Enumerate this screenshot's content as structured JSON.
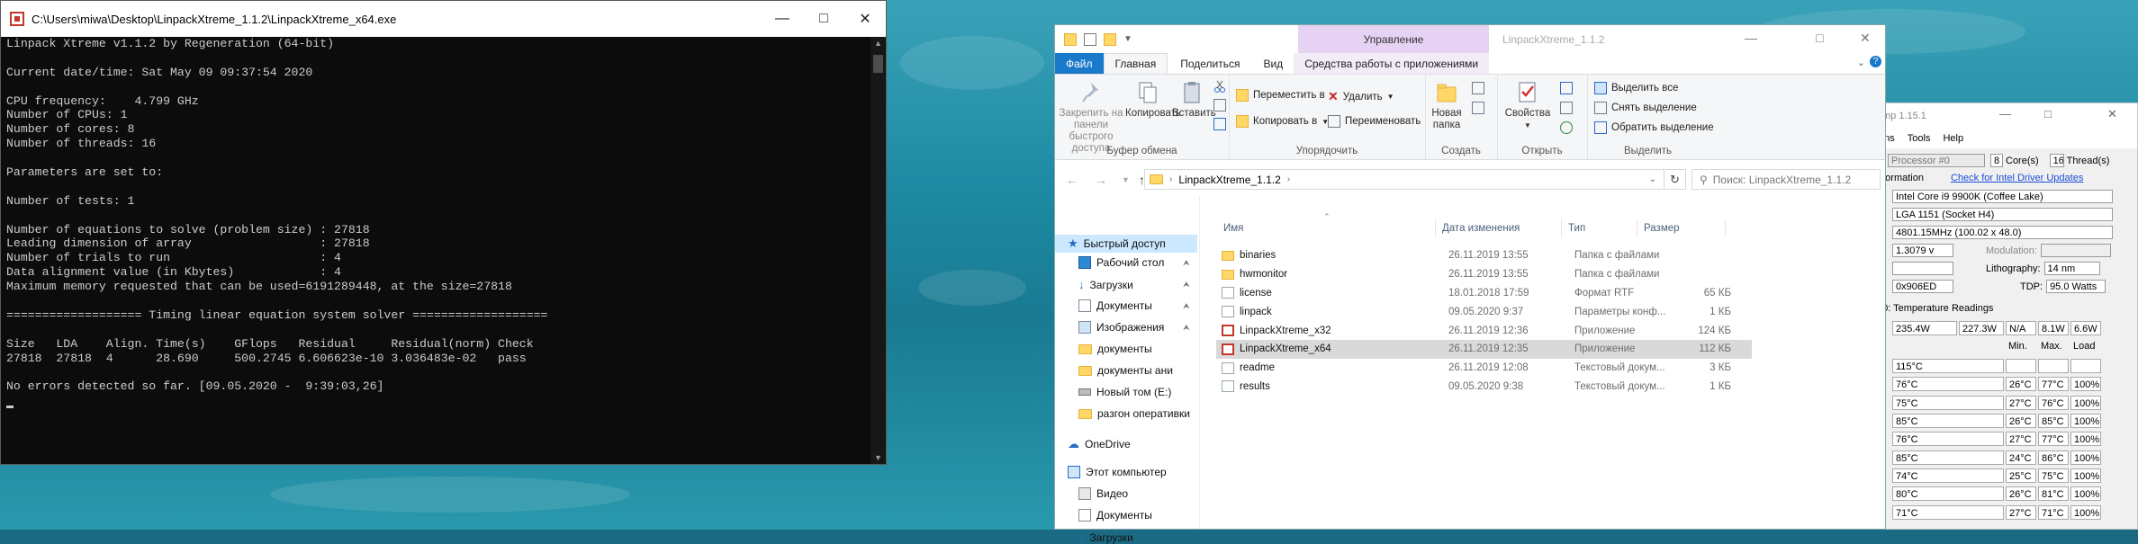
{
  "console": {
    "title": "C:\\Users\\miwa\\Desktop\\LinpackXtreme_1.1.2\\LinpackXtreme_x64.exe",
    "lines": [
      "Linpack Xtreme v1.1.2 by Regeneration (64-bit)",
      "",
      "Current date/time: Sat May 09 09:37:54 2020",
      "",
      "CPU frequency:    4.799 GHz",
      "Number of CPUs: 1",
      "Number of cores: 8",
      "Number of threads: 16",
      "",
      "Parameters are set to:",
      "",
      "Number of tests: 1",
      "",
      "Number of equations to solve (problem size) : 27818",
      "Leading dimension of array                  : 27818",
      "Number of trials to run                     : 4",
      "Data alignment value (in Kbytes)            : 4",
      "Maximum memory requested that can be used=6191289448, at the size=27818",
      "",
      "=================== Timing linear equation system solver ===================",
      "",
      "Size   LDA    Align. Time(s)    GFlops   Residual     Residual(norm) Check",
      "27818  27818  4      28.690     500.2745 6.606623e-10 3.036483e-02   pass",
      "",
      "No errors detected so far. [09.05.2020 -  9:39:03,26]"
    ]
  },
  "explorer": {
    "title": "LinpackXtreme_1.1.2",
    "context_tab": "Управление",
    "tabs": [
      "Файл",
      "Главная",
      "Поделиться",
      "Вид",
      "Средства работы с приложениями"
    ],
    "ribbon": {
      "pin_label": "Закрепить на панели быстрого доступа",
      "copy_label": "Копировать",
      "paste_label": "Вставить",
      "clipboard_group": "Буфер обмена",
      "move_to": "Переместить в",
      "copy_to": "Копировать в",
      "delete": "Удалить",
      "rename": "Переименовать",
      "organize_group": "Упорядочить",
      "new_folder": "Новая папка",
      "create_group": "Создать",
      "properties": "Свойства",
      "open_group": "Открыть",
      "select_all": "Выделить все",
      "select_none": "Снять выделение",
      "invert_selection": "Обратить выделение",
      "select_group": "Выделить"
    },
    "address": "LinpackXtreme_1.1.2",
    "search_placeholder": "Поиск: LinpackXtreme_1.1.2",
    "nav": [
      "Быстрый доступ",
      "Рабочий стол",
      "Загрузки",
      "Документы",
      "Изображения",
      "документы",
      "документы ани",
      "Новый том (E:)",
      "разгон оперативки",
      "OneDrive",
      "Этот компьютер",
      "Видео",
      "Документы",
      "Загрузки"
    ],
    "columns": [
      "Имя",
      "Дата изменения",
      "Тип",
      "Размер"
    ],
    "files": [
      {
        "name": "binaries",
        "date": "26.11.2019 13:55",
        "type": "Папка с файлами",
        "size": "",
        "icon": "folder"
      },
      {
        "name": "hwmonitor",
        "date": "26.11.2019 13:55",
        "type": "Папка с файлами",
        "size": "",
        "icon": "folder"
      },
      {
        "name": "license",
        "date": "18.01.2018 17:59",
        "type": "Формат RTF",
        "size": "65 КБ",
        "icon": "doc"
      },
      {
        "name": "linpack",
        "date": "09.05.2020 9:37",
        "type": "Параметры конф...",
        "size": "1 КБ",
        "icon": "doc"
      },
      {
        "name": "LinpackXtreme_x32",
        "date": "26.11.2019 12:36",
        "type": "Приложение",
        "size": "124 КБ",
        "icon": "app"
      },
      {
        "name": "LinpackXtreme_x64",
        "date": "26.11.2019 12:35",
        "type": "Приложение",
        "size": "112 КБ",
        "icon": "app"
      },
      {
        "name": "readme",
        "date": "26.11.2019 12:08",
        "type": "Текстовый докум...",
        "size": "3 КБ",
        "icon": "doc"
      },
      {
        "name": "results",
        "date": "09.05.2020 9:38",
        "type": "Текстовый докум...",
        "size": "1 КБ",
        "icon": "doc"
      }
    ]
  },
  "hwmonitor": {
    "title": "mp 1.15.1",
    "menu": [
      "ons",
      "Tools",
      "Help"
    ],
    "processor_select": "Processor #0",
    "cores_value": "8",
    "cores_label": "Core(s)",
    "threads_value": "16",
    "threads_label": "Thread(s)",
    "info_label": "nformation",
    "driver_link": "Check for Intel Driver Updates",
    "cpu_name": "Intel Core i9 9900K (Coffee Lake)",
    "socket": "LGA 1151 (Socket H4)",
    "clock": "4801.15MHz (100.02 x 48.0)",
    "voltage": "1.3079 v",
    "modulation_label": "Modulation:",
    "lithography_label": "Lithography:",
    "lithography": "14 nm",
    "stepping": "0x906ED",
    "tdp_label": "TDP:",
    "tdp": "95.0 Watts",
    "temp_header": "#0: Temperature Readings",
    "power_row": [
      "235.4W",
      "227.3W",
      "N/A",
      "8.1W",
      "6.6W"
    ],
    "temp_cols": [
      "",
      "Min.",
      "Max.",
      "Load"
    ],
    "temp_rows": [
      [
        "115°C",
        "",
        "",
        ""
      ],
      [
        "76°C",
        "26°C",
        "77°C",
        "100%"
      ],
      [
        "75°C",
        "27°C",
        "76°C",
        "100%"
      ],
      [
        "85°C",
        "26°C",
        "85°C",
        "100%"
      ],
      [
        "76°C",
        "27°C",
        "77°C",
        "100%"
      ],
      [
        "85°C",
        "24°C",
        "86°C",
        "100%"
      ],
      [
        "74°C",
        "25°C",
        "75°C",
        "100%"
      ],
      [
        "80°C",
        "26°C",
        "81°C",
        "100%"
      ],
      [
        "71°C",
        "27°C",
        "71°C",
        "100%"
      ]
    ]
  }
}
